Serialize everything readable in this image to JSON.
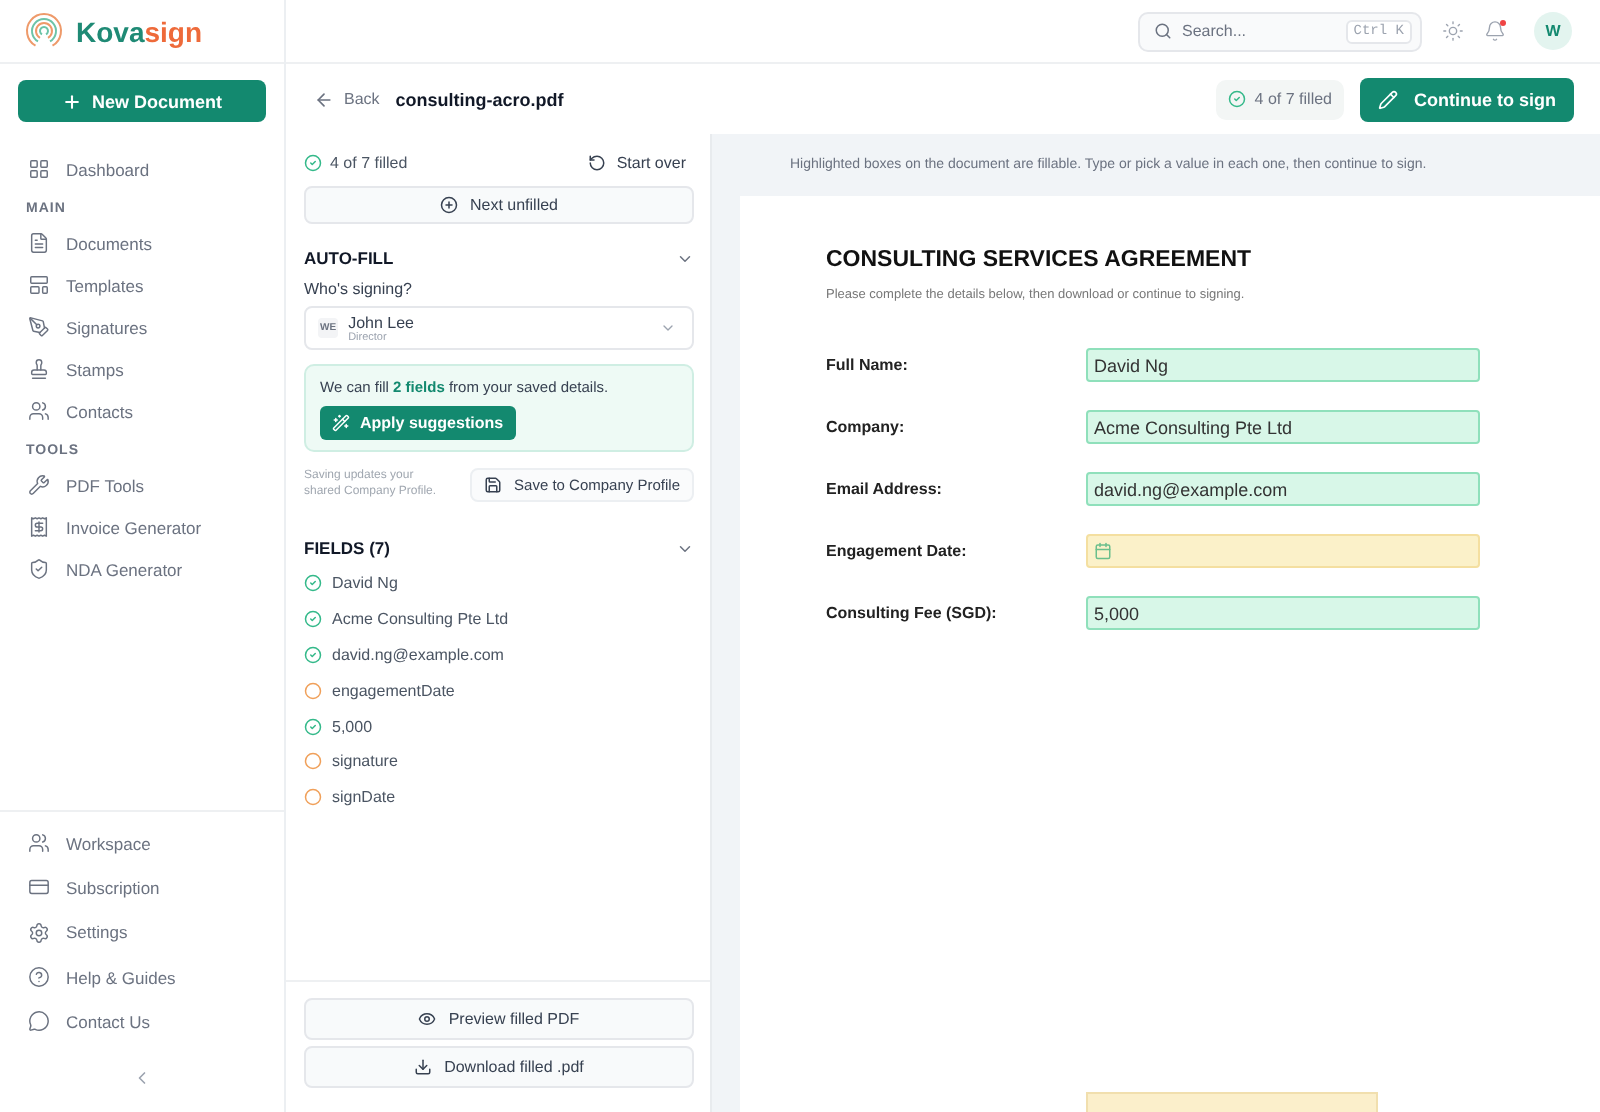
{
  "brand": {
    "name_first": "Kova",
    "name_second": "sign"
  },
  "new_document": "New Document",
  "sidebar": {
    "top_items": [
      {
        "label": "Dashboard"
      }
    ],
    "sections": [
      {
        "title": "MAIN",
        "items": [
          {
            "label": "Documents"
          },
          {
            "label": "Templates"
          },
          {
            "label": "Signatures"
          },
          {
            "label": "Stamps"
          },
          {
            "label": "Contacts"
          }
        ]
      },
      {
        "title": "TOOLS",
        "items": [
          {
            "label": "PDF Tools"
          },
          {
            "label": "Invoice Generator"
          },
          {
            "label": "NDA Generator"
          }
        ]
      }
    ],
    "bottom_items": [
      {
        "label": "Workspace"
      },
      {
        "label": "Subscription"
      },
      {
        "label": "Settings"
      },
      {
        "label": "Help & Guides"
      },
      {
        "label": "Contact Us"
      }
    ]
  },
  "topbar": {
    "search": {
      "placeholder": "Search...",
      "shortcut": "Ctrl K"
    },
    "notification_unread": true,
    "avatar": "W"
  },
  "header": {
    "back": "Back",
    "filename": "consulting-acro.pdf",
    "progress": "4 of 7 filled",
    "continue": "Continue to sign"
  },
  "panel": {
    "progress": "4 of 7 filled",
    "start_over": "Start over",
    "next_unfilled": "Next unfilled",
    "autofill": {
      "title": "AUTO-FILL",
      "expanded": true,
      "signer_label": "Who's signing?",
      "signer": {
        "initials": "WE",
        "name": "John Lee",
        "role": "Director"
      },
      "suggestion": "We can fill **2 fields** from your saved details.",
      "apply": "Apply suggestions",
      "save_note": "Saving updates your shared Company Profile.",
      "save": "Save to Company Profile"
    },
    "fields_title": "FIELDS (7)",
    "fields_expanded": true,
    "fields": [
      {
        "label": "David Ng",
        "filled": true
      },
      {
        "label": "Acme Consulting Pte Ltd",
        "filled": true
      },
      {
        "label": "david.ng@example.com",
        "filled": true
      },
      {
        "label": "engagementDate",
        "filled": false
      },
      {
        "label": "5,000",
        "filled": true
      },
      {
        "label": "signature",
        "filled": false
      },
      {
        "label": "signDate",
        "filled": false
      }
    ],
    "preview": "Preview filled PDF",
    "download": "Download filled .pdf"
  },
  "document": {
    "hint": "Highlighted boxes on the document are fillable. Type or pick a value in each one, then continue to sign.",
    "title": "CONSULTING SERVICES AGREEMENT",
    "subtitle": "Please complete the details below, then download or continue to signing.",
    "fields": [
      {
        "kind": "text",
        "label": "Full Name:",
        "value": "David Ng",
        "filled": true
      },
      {
        "kind": "text",
        "label": "Company:",
        "value": "Acme Consulting Pte Ltd",
        "filled": true
      },
      {
        "kind": "text",
        "label": "Email Address:",
        "value": "david.ng@example.com",
        "filled": true
      },
      {
        "kind": "date",
        "label": "Engagement Date:",
        "filled": false
      },
      {
        "kind": "text",
        "label": "Consulting Fee (SGD):",
        "value": "5,000",
        "filled": true
      }
    ],
    "signature_box": {
      "filled": false
    }
  }
}
